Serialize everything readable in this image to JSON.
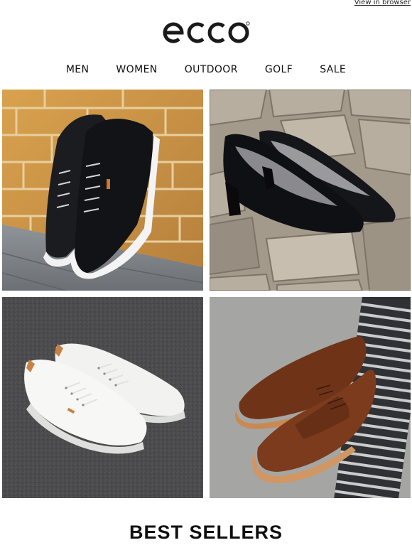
{
  "header": {
    "view_in_browser": "View in browser",
    "logo_text": "ecco"
  },
  "nav": {
    "items": [
      {
        "label": "MEN"
      },
      {
        "label": "WOMEN"
      },
      {
        "label": "OUTDOOR"
      },
      {
        "label": "GOLF"
      },
      {
        "label": "SALE"
      }
    ]
  },
  "tiles": [
    {
      "icon": "black-sneakers-photo"
    },
    {
      "icon": "black-pumps-photo"
    },
    {
      "icon": "white-sneakers-photo"
    },
    {
      "icon": "brown-derby-shoes-photo"
    }
  ],
  "section": {
    "title": "BEST SELLERS"
  }
}
